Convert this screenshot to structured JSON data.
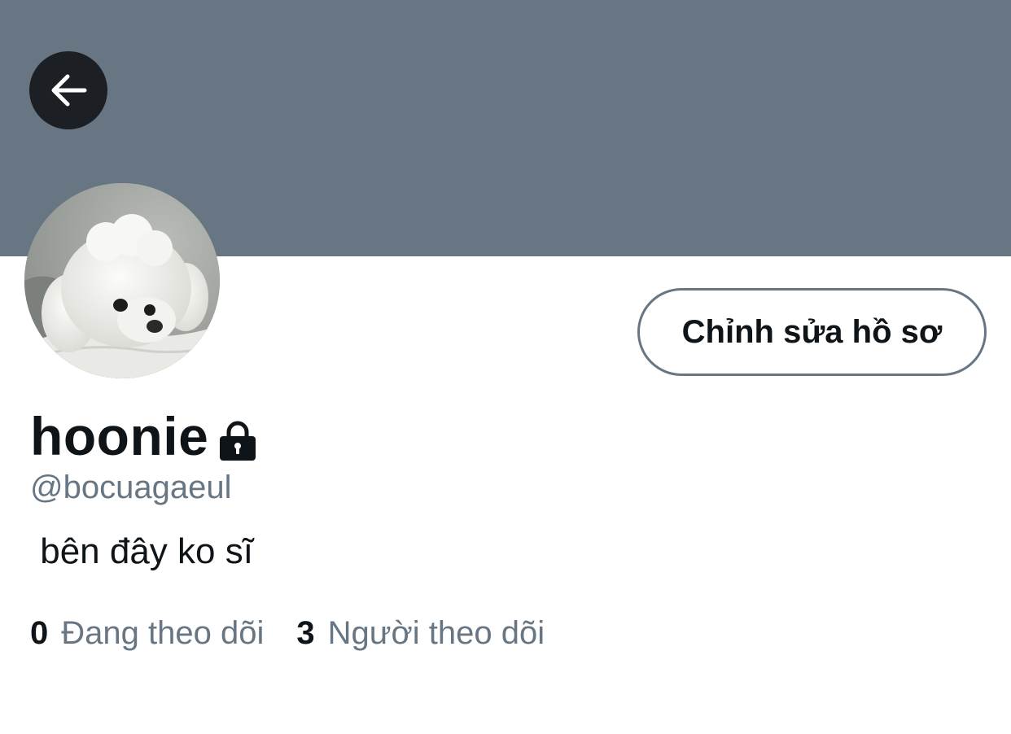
{
  "header": {
    "back_icon": "arrow-left-icon",
    "banner_color": "#687684"
  },
  "profile": {
    "avatar_alt": "poodle-avatar",
    "display_name": "hoonie",
    "protected_icon": "lock-icon",
    "handle": "@bocuagaeul",
    "bio": " bên đây ko sĩ",
    "edit_button_label": "Chỉnh sửa hồ sơ"
  },
  "stats": {
    "following_count": "0",
    "following_label": "Đang theo dõi",
    "followers_count": "3",
    "followers_label": "Người theo dõi"
  },
  "colors": {
    "text_primary": "#0f1419",
    "text_secondary": "#687684",
    "button_dark": "#1c1f23"
  }
}
